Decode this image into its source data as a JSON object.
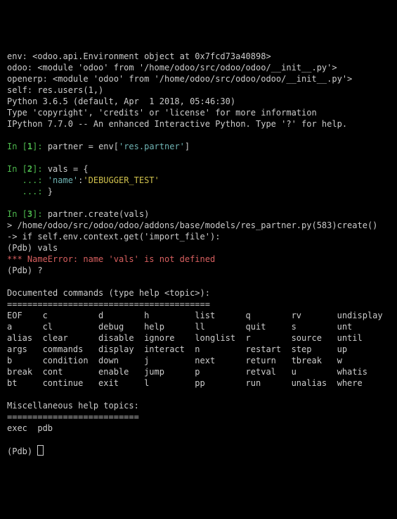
{
  "header": {
    "l1": "env: <odoo.api.Environment object at 0x7fcd73a40898>",
    "l2": "odoo: <module 'odoo' from '/home/odoo/src/odoo/odoo/__init__.py'>",
    "l3": "openerp: <module 'odoo' from '/home/odoo/src/odoo/odoo/__init__.py'>",
    "l4": "self: res.users(1,)",
    "l5": "Python 3.6.5 (default, Apr  1 2018, 05:46:30)",
    "l6": "Type 'copyright', 'credits' or 'license' for more information",
    "l7": "IPython 7.7.0 -- An enhanced Interactive Python. Type '?' for help."
  },
  "in1": {
    "pre": "In [",
    "num": "1",
    "post": "]: ",
    "code_a": "partner = env[",
    "str": "'res.partner'",
    "code_b": "]"
  },
  "in2": {
    "pre": "In [",
    "num": "2",
    "post": "]: ",
    "code": "vals = {",
    "cont_a": "   ...: ",
    "key": "'name'",
    "colon": ":",
    "val": "'DEBUGGER_TEST'",
    "cont_b": "   ...: ",
    "close": "}"
  },
  "in3": {
    "pre": "In [",
    "num": "3",
    "post": "]: ",
    "code": "partner.create(vals)"
  },
  "trace": {
    "l1": "> /home/odoo/src/odoo/odoo/addons/base/models/res_partner.py(583)create()",
    "l2": "-> if self.env.context.get('import_file'):",
    "l3": "(Pdb) vals",
    "err": "*** NameError: name 'vals' is not defined",
    "l5": "(Pdb) ?"
  },
  "help": {
    "title": "Documented commands (type help <topic>):",
    "sep1": "========================================",
    "r1": "EOF    c          d        h         list      q        rv       undisplay",
    "r2": "a      cl         debug    help      ll        quit     s        unt",
    "r3": "alias  clear      disable  ignore    longlist  r        source   until",
    "r4": "args   commands   display  interact  n         restart  step     up",
    "r5": "b      condition  down     j         next      return   tbreak   w",
    "r6": "break  cont       enable   jump      p         retval   u        whatis",
    "r7": "bt     continue   exit     l         pp        run      unalias  where",
    "misc_title": "Miscellaneous help topics:",
    "sep2": "==========================",
    "misc": "exec  pdb"
  },
  "prompt": "(Pdb) "
}
